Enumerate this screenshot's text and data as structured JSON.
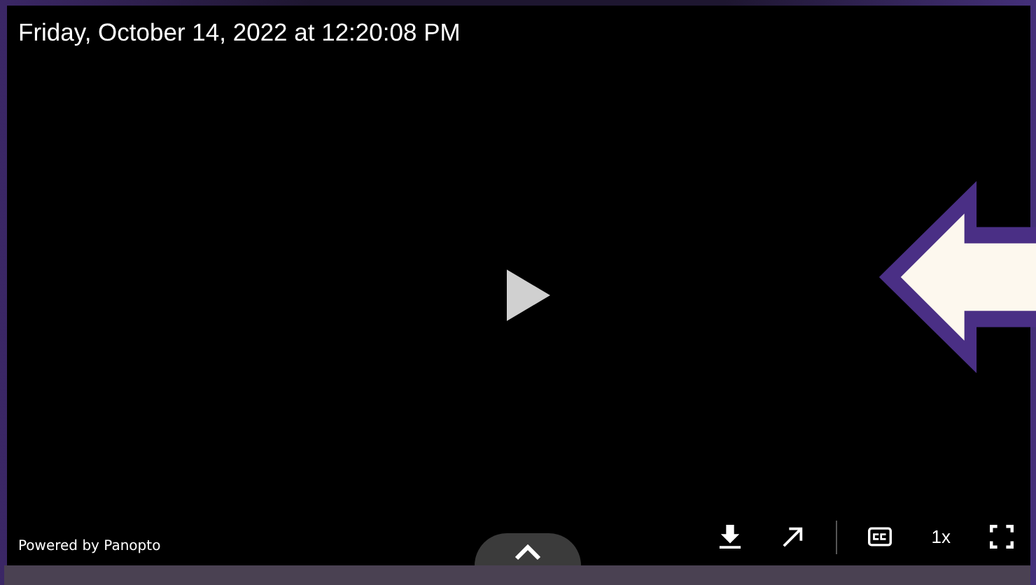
{
  "video": {
    "timestamp": "Friday, October 14, 2022 at 12:20:08 PM",
    "branding": "Powered by Panopto"
  },
  "controls": {
    "speed": "1x"
  }
}
